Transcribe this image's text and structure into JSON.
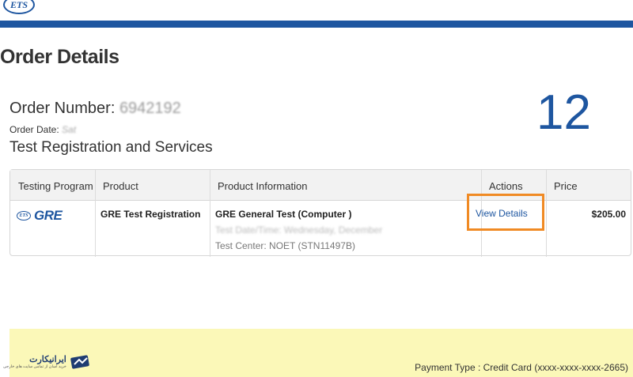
{
  "header": {
    "logo_text": "ETS"
  },
  "page_title": "Order Details",
  "order": {
    "number_label": "Order Number:",
    "number_value": "6942192",
    "date_label": "Order Date:",
    "date_value": "Sat"
  },
  "section_title": "Test Registration and Services",
  "step_number": "12",
  "table": {
    "columns": [
      "Testing Program",
      "Product",
      "Product Information",
      "Actions",
      "Price"
    ],
    "row": {
      "program_logo_ets": "ETS",
      "program_logo_text": "GRE",
      "product": "GRE Test Registration",
      "info_title": "GRE General Test (Computer )",
      "info_date_partial": "Test Date/Time: Wednesday, December",
      "info_center": "Test Center: NOET (STN11497B)",
      "action_label": "View Details",
      "price": "$205.00"
    }
  },
  "payment": {
    "text": "Payment Type : Credit Card (xxxx-xxxx-xxxx-2665)"
  },
  "watermark": {
    "title": "ایرانیکارت",
    "subtitle": "خرید آسان از تمامی سایت های خارجی"
  },
  "colors": {
    "brand_blue": "#1e56a0",
    "highlight_orange": "#f08a24",
    "band_yellow": "#fbf8b8"
  }
}
